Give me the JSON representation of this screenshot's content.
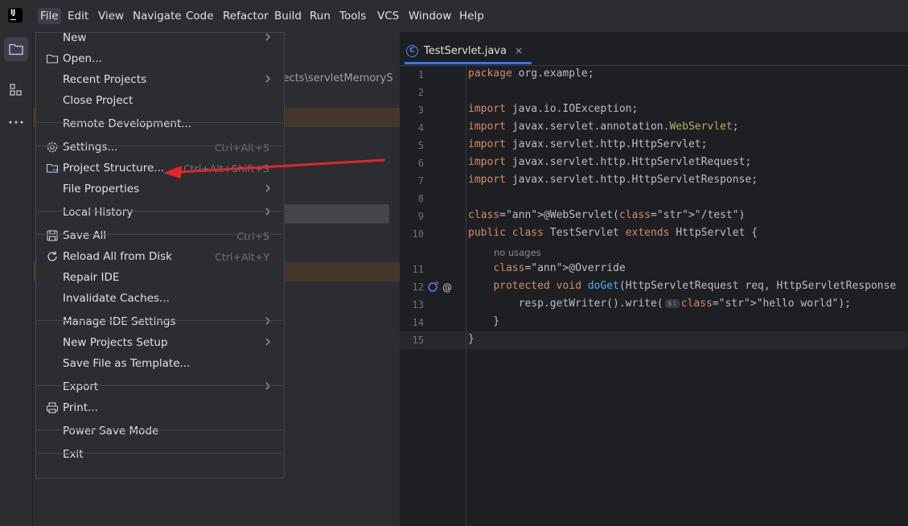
{
  "menubar": {
    "items": [
      "File",
      "Edit",
      "View",
      "Navigate",
      "Code",
      "Refactor",
      "Build",
      "Run",
      "Tools",
      "VCS",
      "Window",
      "Help"
    ],
    "logo_text": "IJ"
  },
  "toolstrip": {
    "icons": [
      "folder-icon",
      "structure-icon",
      "more-icon"
    ]
  },
  "project": {
    "path_fragment": "ojects\\servletMemoryS"
  },
  "editor": {
    "tab_label": "TestServlet.java",
    "tab_icon_glyph": "C",
    "tab_close": "×",
    "lines": [
      {
        "n": "1",
        "code": "package org.example;"
      },
      {
        "n": "2",
        "code": ""
      },
      {
        "n": "3",
        "code": "import java.io.IOException;"
      },
      {
        "n": "4",
        "code": "import javax.servlet.annotation.WebServlet;"
      },
      {
        "n": "5",
        "code": "import javax.servlet.http.HttpServlet;"
      },
      {
        "n": "6",
        "code": "import javax.servlet.http.HttpServletRequest;"
      },
      {
        "n": "7",
        "code": "import javax.servlet.http.HttpServletResponse;"
      },
      {
        "n": "8",
        "code": ""
      },
      {
        "n": "9",
        "code": "@WebServlet(\"/test\")"
      },
      {
        "n": "10",
        "code": "public class TestServlet extends HttpServlet {"
      },
      {
        "n": "11",
        "code": "    @Override"
      },
      {
        "n": "12",
        "code": "    protected void doGet(HttpServletRequest req, HttpServletResponse"
      },
      {
        "n": "13",
        "code": "        resp.getWriter().write(\"hello world\");"
      },
      {
        "n": "14",
        "code": "    }"
      },
      {
        "n": "15",
        "code": "}"
      }
    ],
    "usage_hint": "no usages",
    "param_hint": "s:"
  },
  "file_menu": {
    "items": [
      {
        "label": "New",
        "shortcut": "",
        "submenu": true,
        "icon": ""
      },
      {
        "label": "Open...",
        "shortcut": "",
        "submenu": false,
        "icon": "folder-icon"
      },
      {
        "label": "Recent Projects",
        "shortcut": "",
        "submenu": true,
        "icon": ""
      },
      {
        "label": "Close Project",
        "shortcut": "",
        "submenu": false,
        "icon": ""
      },
      {
        "label": "Remote Development...",
        "shortcut": "",
        "submenu": false,
        "icon": ""
      },
      {
        "label": "Settings...",
        "shortcut": "Ctrl+Alt+S",
        "submenu": false,
        "icon": "gear-icon"
      },
      {
        "label": "Project Structure...",
        "shortcut": "Ctrl+Alt+Shift+S",
        "submenu": false,
        "icon": "project-structure-icon"
      },
      {
        "label": "File Properties",
        "shortcut": "",
        "submenu": true,
        "icon": ""
      },
      {
        "label": "Local History",
        "shortcut": "",
        "submenu": true,
        "icon": ""
      },
      {
        "label": "Save All",
        "shortcut": "Ctrl+S",
        "submenu": false,
        "icon": "save-icon"
      },
      {
        "label": "Reload All from Disk",
        "shortcut": "Ctrl+Alt+Y",
        "submenu": false,
        "icon": "reload-icon"
      },
      {
        "label": "Repair IDE",
        "shortcut": "",
        "submenu": false,
        "icon": ""
      },
      {
        "label": "Invalidate Caches...",
        "shortcut": "",
        "submenu": false,
        "icon": ""
      },
      {
        "label": "Manage IDE Settings",
        "shortcut": "",
        "submenu": true,
        "icon": ""
      },
      {
        "label": "New Projects Setup",
        "shortcut": "",
        "submenu": true,
        "icon": ""
      },
      {
        "label": "Save File as Template...",
        "shortcut": "",
        "submenu": false,
        "icon": ""
      },
      {
        "label": "Export",
        "shortcut": "",
        "submenu": true,
        "icon": ""
      },
      {
        "label": "Print...",
        "shortcut": "",
        "submenu": false,
        "icon": "print-icon"
      },
      {
        "label": "Power Save Mode",
        "shortcut": "",
        "submenu": false,
        "icon": ""
      },
      {
        "label": "Exit",
        "shortcut": "",
        "submenu": false,
        "icon": ""
      }
    ]
  },
  "colors": {
    "accent": "#3574f0",
    "annotation_arrow": "#e5242b",
    "keyword": "#cf8e6d",
    "string": "#6aab73"
  }
}
